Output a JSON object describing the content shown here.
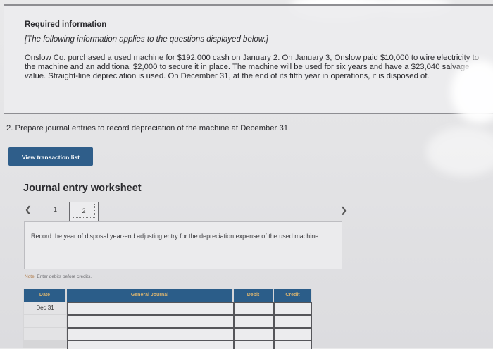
{
  "info": {
    "title": "Required information",
    "note": "[The following information applies to the questions displayed below.]",
    "body": "Onslow Co. purchased a used machine for $192,000 cash on January 2. On January 3, Onslow paid $10,000 to wire electricity to the machine and an additional $2,000 to secure it in place. The machine will be used for six years and have a $23,040 salvage value. Straight-line depreciation is used. On December 31, at the end of its fifth year in operations, it is disposed of."
  },
  "question": "2. Prepare journal entries to record depreciation of the machine at December 31.",
  "view_button": "View transaction list",
  "worksheet": {
    "title": "Journal entry worksheet",
    "prev_icon": "chevron-left-icon",
    "next_icon": "chevron-right-icon",
    "pages": [
      "1",
      "2"
    ],
    "current_page": "2",
    "instruction": "Record the year of disposal year-end adjusting entry for the depreciation expense of the used machine.",
    "note_label": "Note:",
    "note_text": "Enter debits before credits.",
    "table": {
      "headers": {
        "date": "Date",
        "journal": "General Journal",
        "debit": "Debit",
        "credit": "Credit"
      },
      "rows": [
        {
          "date": "Dec 31",
          "account": "",
          "debit": "",
          "credit": ""
        },
        {
          "date": "",
          "account": "",
          "debit": "",
          "credit": ""
        },
        {
          "date": "",
          "account": "",
          "debit": "",
          "credit": ""
        }
      ]
    }
  },
  "colors": {
    "button_bg": "#2f5e8a",
    "table_header_bg": "#2b5d89",
    "table_header_text": "#d8b370",
    "note_label": "#b07b49"
  }
}
